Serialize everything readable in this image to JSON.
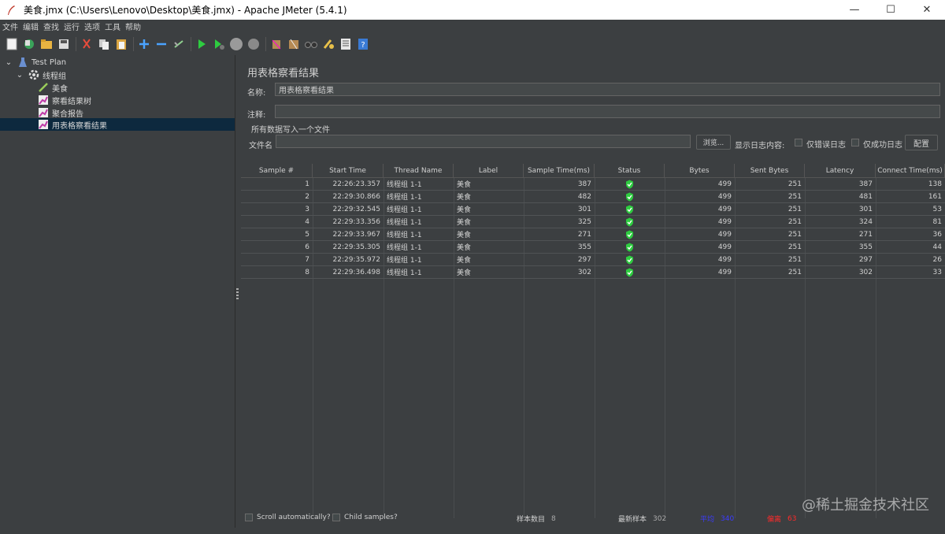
{
  "window": {
    "title": "美食.jmx (C:\\Users\\Lenovo\\Desktop\\美食.jmx) - Apache JMeter (5.4.1)",
    "minimize": "—",
    "maximize": "☐",
    "close": "✕"
  },
  "menu": [
    "文件",
    "编辑",
    "查找",
    "运行",
    "选项",
    "工具",
    "帮助"
  ],
  "toolbar_icons": [
    "new-icon",
    "templates-icon",
    "open-icon",
    "save-icon",
    "cut-icon",
    "copy-icon",
    "paste-icon",
    "expand-icon",
    "collapse-icon",
    "toggle-icon",
    "start-icon",
    "start-no-pause-icon",
    "stop-icon",
    "shutdown-icon",
    "clear-icon",
    "clear-all-icon",
    "search-icon",
    "reset-search-icon",
    "function-helper-icon",
    "help-icon"
  ],
  "tree": {
    "items": [
      {
        "label": "Test Plan",
        "icon": "test-plan-icon",
        "depth": 0
      },
      {
        "label": "线程组",
        "icon": "thread-group-icon",
        "depth": 1
      },
      {
        "label": "美食",
        "icon": "http-sampler-icon",
        "depth": 2
      },
      {
        "label": "察看结果树",
        "icon": "listener-icon",
        "depth": 2
      },
      {
        "label": "聚合报告",
        "icon": "listener-icon",
        "depth": 2
      },
      {
        "label": "用表格察看结果",
        "icon": "listener-icon",
        "depth": 2,
        "selected": true
      }
    ]
  },
  "panel": {
    "title": "用表格察看结果",
    "name_label": "名称:",
    "name_value": "用表格察看结果",
    "comment_label": "注释:",
    "comment_value": "",
    "file_section": "所有数据写入一个文件",
    "file_label": "文件名",
    "file_value": "",
    "browse_button": "浏览...",
    "log_label": "显示日志内容:",
    "errors_only": "仅错误日志",
    "success_only": "仅成功日志",
    "configure_button": "配置"
  },
  "table": {
    "columns": [
      "Sample #",
      "Start Time",
      "Thread Name",
      "Label",
      "Sample Time(ms)",
      "Status",
      "Bytes",
      "Sent Bytes",
      "Latency",
      "Connect Time(ms)"
    ],
    "rows": [
      [
        "1",
        "22:26:23.357",
        "线程组 1-1",
        "美食",
        "387",
        "ok",
        "499",
        "251",
        "387",
        "138"
      ],
      [
        "2",
        "22:29:30.866",
        "线程组 1-1",
        "美食",
        "482",
        "ok",
        "499",
        "251",
        "481",
        "161"
      ],
      [
        "3",
        "22:29:32.545",
        "线程组 1-1",
        "美食",
        "301",
        "ok",
        "499",
        "251",
        "301",
        "53"
      ],
      [
        "4",
        "22:29:33.356",
        "线程组 1-1",
        "美食",
        "325",
        "ok",
        "499",
        "251",
        "324",
        "81"
      ],
      [
        "5",
        "22:29:33.967",
        "线程组 1-1",
        "美食",
        "271",
        "ok",
        "499",
        "251",
        "271",
        "36"
      ],
      [
        "6",
        "22:29:35.305",
        "线程组 1-1",
        "美食",
        "355",
        "ok",
        "499",
        "251",
        "355",
        "44"
      ],
      [
        "7",
        "22:29:35.972",
        "线程组 1-1",
        "美食",
        "297",
        "ok",
        "499",
        "251",
        "297",
        "26"
      ],
      [
        "8",
        "22:29:36.498",
        "线程组 1-1",
        "美食",
        "302",
        "ok",
        "499",
        "251",
        "302",
        "33"
      ]
    ]
  },
  "footer": {
    "scroll_auto": "Scroll automatically?",
    "child_samples": "Child samples?",
    "sample_count_label": "样本数目",
    "sample_count_value": "8",
    "latest_label": "最新样本",
    "latest_value": "302",
    "average_label": "平均",
    "average_value": "340",
    "deviation_label": "偏离",
    "deviation_value": "63"
  },
  "watermark": "@稀土掘金技术社区",
  "colors": {
    "background": "#3c3f41",
    "selection": "#0d293e",
    "status_ok": "#2ecc40",
    "average_color": "#3b3bff",
    "deviation_color": "#ff2a2a"
  }
}
